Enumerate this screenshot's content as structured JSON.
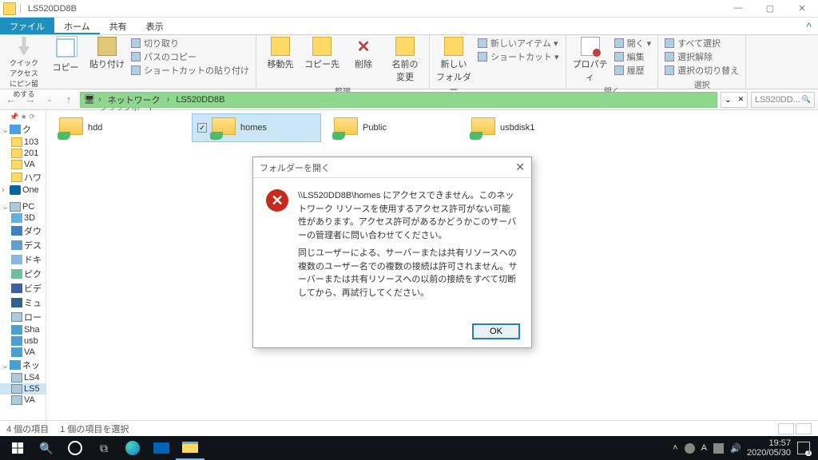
{
  "window": {
    "title": "LS520DD8B",
    "controls": {
      "min": "—",
      "max": "▢",
      "close": "✕"
    }
  },
  "ribbon_tabs": {
    "file": "ファイル",
    "home": "ホーム",
    "share": "共有",
    "view": "表示",
    "help": "^"
  },
  "ribbon": {
    "clipboard": {
      "label": "クリップボード",
      "quick_access": "クイック アクセス\nにピン留めする",
      "copy": "コピー",
      "paste": "貼り付け",
      "cut": "切り取り",
      "copy_path": "パスのコピー",
      "paste_shortcut": "ショートカットの貼り付け"
    },
    "organize": {
      "label": "整理",
      "move_to": "移動先",
      "copy_to": "コピー先",
      "delete": "削除",
      "rename": "名前の\n変更"
    },
    "new": {
      "label": "新規",
      "new_folder": "新しい\nフォルダー",
      "new_item": "新しいアイテム ▾",
      "shortcut": "ショートカット ▾"
    },
    "open": {
      "label": "開く",
      "properties": "プロパティ",
      "open": "開く ▾",
      "edit": "編集",
      "history": "履歴"
    },
    "select": {
      "label": "選択",
      "select_all": "すべて選択",
      "select_none": "選択解除",
      "invert": "選択の切り替え"
    }
  },
  "address": {
    "back": "←",
    "forward": "→",
    "up": "↑",
    "crumb1": "ネットワーク",
    "crumb2": "LS520DD8B",
    "refresh": "↻",
    "collapse": "⌄",
    "close_x": "✕",
    "search_placeholder": "LS520DD...",
    "search_icon": "🔍"
  },
  "tree": {
    "items": [
      {
        "icon": "ti-qa",
        "label": "ク",
        "arrow": "⌄",
        "indent": 0
      },
      {
        "icon": "ti-fold",
        "label": "103",
        "indent": 1
      },
      {
        "icon": "ti-fold",
        "label": "201",
        "indent": 1
      },
      {
        "icon": "ti-fold",
        "label": "VA",
        "indent": 1
      },
      {
        "icon": "ti-fold",
        "label": "ハワ",
        "indent": 1
      },
      {
        "icon": "ti-od",
        "label": "One",
        "arrow": "›",
        "indent": 0
      },
      {
        "icon": "ti-pc",
        "label": "PC",
        "arrow": "⌄",
        "indent": 0
      },
      {
        "icon": "ti-3d",
        "label": "3D",
        "indent": 1
      },
      {
        "icon": "ti-dl",
        "label": "ダウ",
        "indent": 1
      },
      {
        "icon": "ti-desk",
        "label": "デス",
        "indent": 1
      },
      {
        "icon": "ti-doc",
        "label": "ドキ",
        "indent": 1
      },
      {
        "icon": "ti-pic",
        "label": "ピク",
        "indent": 1
      },
      {
        "icon": "ti-vid",
        "label": "ビデ",
        "indent": 1
      },
      {
        "icon": "ti-mus",
        "label": "ミュ",
        "indent": 1
      },
      {
        "icon": "ti-pc",
        "label": "ロー",
        "indent": 1
      },
      {
        "icon": "ti-net",
        "label": "Sha",
        "indent": 1
      },
      {
        "icon": "ti-net",
        "label": "usb",
        "indent": 1
      },
      {
        "icon": "ti-net",
        "label": "VA",
        "indent": 1
      },
      {
        "icon": "ti-net",
        "label": "ネッ",
        "arrow": "⌄",
        "indent": 0
      },
      {
        "icon": "ti-pc",
        "label": "LS4",
        "indent": 1
      },
      {
        "icon": "ti-pc",
        "label": "LS5",
        "indent": 1,
        "sel": true
      },
      {
        "icon": "ti-pc",
        "label": "VA",
        "indent": 1
      }
    ]
  },
  "folders": [
    {
      "name": "hdd"
    },
    {
      "name": "homes",
      "selected": true
    },
    {
      "name": "Public"
    },
    {
      "name": "usbdisk1"
    }
  ],
  "dialog": {
    "title": "フォルダーを開く",
    "line1": "\\\\LS520DD8B\\homes にアクセスできません。このネットワーク リソースを使用するアクセス許可がない可能性があります。アクセス許可があるかどうかこのサーバーの管理者に問い合わせてください。",
    "line2": "同じユーザーによる、サーバーまたは共有リソースへの複数のユーザー名での複数の接続は許可されません。サーバーまたは共有リソースへの以前の接続をすべて切断してから、再試行してください。",
    "ok": "OK",
    "close": "✕"
  },
  "status": {
    "count": "4 個の項目",
    "selected": "1 個の項目を選択"
  },
  "taskbar": {
    "ime": "A",
    "time": "19:57",
    "date": "2020/05/30",
    "notif_count": "3"
  }
}
